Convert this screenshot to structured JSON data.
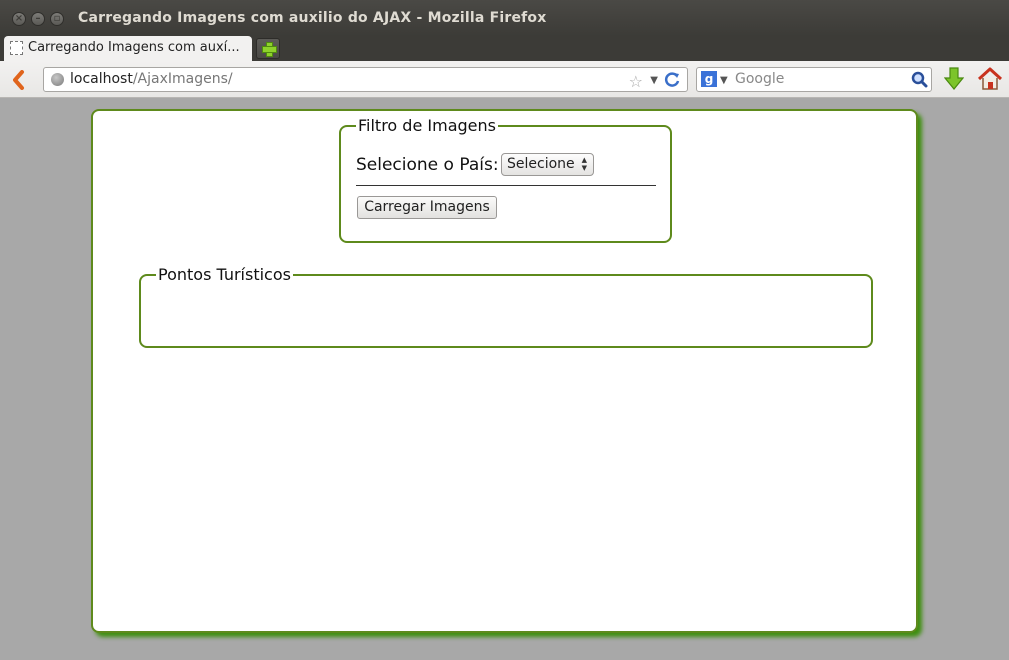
{
  "window": {
    "title": "Carregando Imagens com auxilio do AJAX - Mozilla Firefox"
  },
  "tabs": [
    {
      "label": "Carregando Imagens com auxí..."
    }
  ],
  "urlbar": {
    "host": "localhost",
    "path": "/AjaxImagens/"
  },
  "search": {
    "placeholder": "Google"
  },
  "page": {
    "filter": {
      "legend": "Filtro de Imagens",
      "pais_label": "Selecione o País:",
      "select_value": "Selecione",
      "button_label": "Carregar Imagens"
    },
    "pontos": {
      "legend": "Pontos Turísticos"
    }
  },
  "colors": {
    "accent_green": "#5e8a1c",
    "shadow_green": "#3f8f10",
    "titlebar": "#3c3b37"
  }
}
